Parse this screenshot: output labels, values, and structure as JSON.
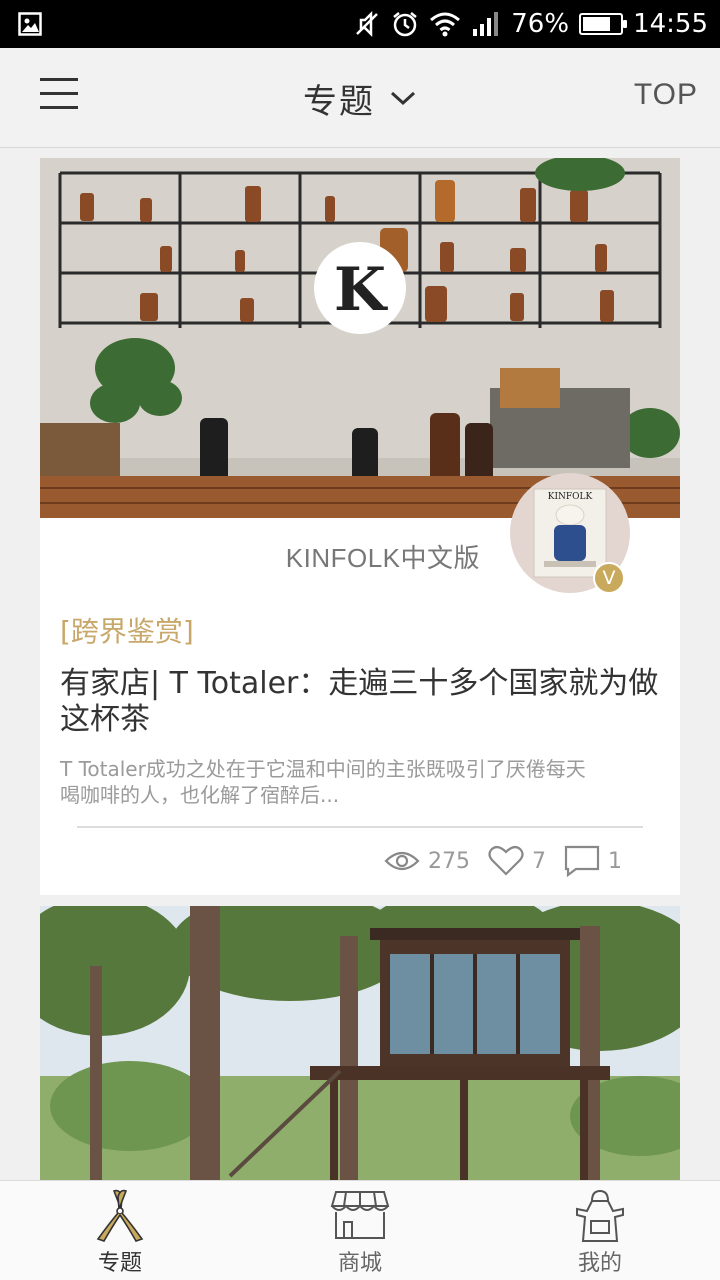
{
  "status_bar": {
    "battery_percent": "76%",
    "battery_level": 0.76,
    "time": "14:55",
    "icons": [
      "gallery-icon",
      "mute-icon",
      "alarm-icon",
      "wifi-icon",
      "signal-icon",
      "battery-icon"
    ]
  },
  "header": {
    "title": "专题",
    "dropdown_icon": "chevron-down-icon",
    "menu_icon": "hamburger-menu-icon",
    "top_label": "TOP"
  },
  "feed": {
    "cards": [
      {
        "cover_logo_letter": "K",
        "author_name": "KINFOLK中文版",
        "avatar_magazine_text": "KINFOLK",
        "verified_badge": "V",
        "category": "[跨界鉴赏]",
        "title": "有家店| T Totaler：走遍三十多个国家就为做这杯茶",
        "summary": "T Totaler成功之处在于它温和中间的主张既吸引了厌倦每天喝咖啡的人，也化解了宿醉后...",
        "views": "275",
        "likes": "7",
        "comments": "1"
      },
      {
        "cover_description_icon": "treehouse-photo"
      }
    ]
  },
  "bottom_nav": {
    "items": [
      {
        "label": "专题",
        "icon": "pruning-shears-icon",
        "active": true
      },
      {
        "label": "商城",
        "icon": "storefront-icon",
        "active": false
      },
      {
        "label": "我的",
        "icon": "apron-icon",
        "active": false
      }
    ]
  },
  "colors": {
    "accent_gold": "#c9a95b",
    "category_gold": "#c8a86a",
    "text_dark": "#333333",
    "text_muted": "#9a9a9a"
  }
}
